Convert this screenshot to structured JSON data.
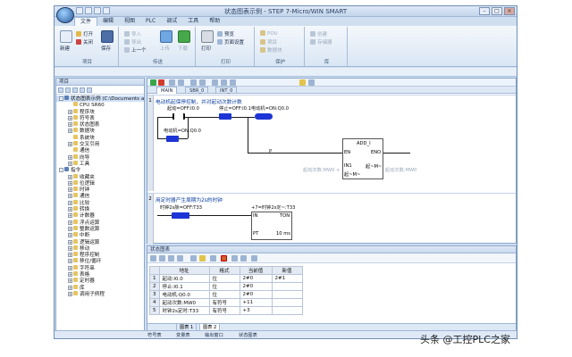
{
  "window": {
    "title": "状态图表示例 - STEP 7-Micro/WIN SMART"
  },
  "menu": [
    "文件",
    "编辑",
    "视图",
    "PLC",
    "调试",
    "工具",
    "帮助"
  ],
  "ribbon": {
    "groups": [
      {
        "label": "项目",
        "buttons": [
          "新建",
          "打开",
          "关闭",
          "保存"
        ]
      },
      {
        "label": "传送",
        "buttons": [
          "导入",
          "导出",
          "上一个",
          "上传",
          "下载"
        ]
      },
      {
        "label": "打印",
        "buttons": [
          "打印",
          "预览",
          "页面设置"
        ]
      },
      {
        "label": "保护",
        "buttons": [
          "POU",
          "项目",
          "数据块"
        ]
      },
      {
        "label": "库",
        "buttons": [
          "创建",
          "存储器"
        ]
      }
    ]
  },
  "nav": {
    "header": "项目",
    "items": [
      {
        "label": "状态图表示例 (C:\\Documents a",
        "level": 0,
        "expander": "-",
        "selected": true
      },
      {
        "label": "CPU SR60",
        "level": 1,
        "expander": ""
      },
      {
        "label": "程序块",
        "level": 1,
        "expander": "+"
      },
      {
        "label": "符号表",
        "level": 1,
        "expander": "+"
      },
      {
        "label": "状态图表",
        "level": 1,
        "expander": "+"
      },
      {
        "label": "数据块",
        "level": 1,
        "expander": "+"
      },
      {
        "label": "系统块",
        "level": 1,
        "expander": ""
      },
      {
        "label": "交叉引用",
        "level": 1,
        "expander": "+"
      },
      {
        "label": "通信",
        "level": 1,
        "expander": ""
      },
      {
        "label": "向导",
        "level": 1,
        "expander": "+"
      },
      {
        "label": "工具",
        "level": 1,
        "expander": "+"
      },
      {
        "label": "指令",
        "level": 0,
        "expander": "-"
      },
      {
        "label": "收藏夹",
        "level": 1,
        "expander": "+"
      },
      {
        "label": "位逻辑",
        "level": 1,
        "expander": "+"
      },
      {
        "label": "时钟",
        "level": 1,
        "expander": "+"
      },
      {
        "label": "通信",
        "level": 1,
        "expander": "+"
      },
      {
        "label": "比较",
        "level": 1,
        "expander": "+"
      },
      {
        "label": "转换",
        "level": 1,
        "expander": "+"
      },
      {
        "label": "计数器",
        "level": 1,
        "expander": "+"
      },
      {
        "label": "浮点运算",
        "level": 1,
        "expander": "+"
      },
      {
        "label": "整数运算",
        "level": 1,
        "expander": "+"
      },
      {
        "label": "中断",
        "level": 1,
        "expander": "+"
      },
      {
        "label": "逻辑运算",
        "level": 1,
        "expander": "+"
      },
      {
        "label": "移动",
        "level": 1,
        "expander": "+"
      },
      {
        "label": "程序控制",
        "level": 1,
        "expander": "+"
      },
      {
        "label": "移位/循环",
        "level": 1,
        "expander": "+"
      },
      {
        "label": "字符串",
        "level": 1,
        "expander": "+"
      },
      {
        "label": "表格",
        "level": 1,
        "expander": "+"
      },
      {
        "label": "定时器",
        "level": 1,
        "expander": "+"
      },
      {
        "label": "库",
        "level": 1,
        "expander": "+"
      },
      {
        "label": "调用子例程",
        "level": 1,
        "expander": "+"
      }
    ]
  },
  "editor": {
    "tabs": [
      "MAIN",
      "SBR_0",
      "INT_0"
    ],
    "networks": [
      {
        "number": "1",
        "comment": "电动机起保停控制，并对起动次数计数",
        "start_label": "起动=OFF:I0.0",
        "stop_label": "停止=OFF:I0.1",
        "motor_label": "电动机=ON:Q0.0",
        "motor_contact_label": "电动机=ON:Q0.0",
        "p_label": "P",
        "block": {
          "name": "ADD_I",
          "en": "EN",
          "eno": "ENO",
          "in1": "IN1",
          "in1_val": "起~M~",
          "in2_val": "起~M~",
          "out_label": "起~M~"
        },
        "out_comment": "起动次数:MW0",
        "faded_left": "起动次数:MW0 +"
      },
      {
        "number": "2",
        "comment": "用定时器产生周期为2s的时钟",
        "clock_label": "时钟2s脉=OFF:T33",
        "timer_label": "+7=时钟2s定~:T33",
        "timer": {
          "in": "IN",
          "type": "TON",
          "pt": "PT",
          "unit": "10 ms"
        }
      }
    ]
  },
  "status_chart": {
    "header": "状态图表",
    "columns": [
      "",
      "地址",
      "格式",
      "当前值",
      "新值"
    ],
    "rows": [
      {
        "n": "1",
        "address": "起动:I0.0",
        "format": "位",
        "current": "2#0",
        "new": "2#1"
      },
      {
        "n": "2",
        "address": "停止:I0.1",
        "format": "位",
        "current": "2#0",
        "new": ""
      },
      {
        "n": "3",
        "address": "电动机:Q0.0",
        "format": "位",
        "current": "2#0",
        "new": ""
      },
      {
        "n": "4",
        "address": "起动次数:MW0",
        "format": "有符号",
        "current": "+11",
        "new": ""
      },
      {
        "n": "5",
        "address": "时钟2s定时:T33",
        "format": "有符号",
        "current": "+3",
        "new": ""
      }
    ],
    "tabs": [
      "图表 1",
      "图表 2"
    ]
  },
  "bottom_tabs": [
    "符号表",
    "变量表",
    "输出窗口",
    "状态图表"
  ],
  "watermark": "头条 @工控PLC之家"
}
